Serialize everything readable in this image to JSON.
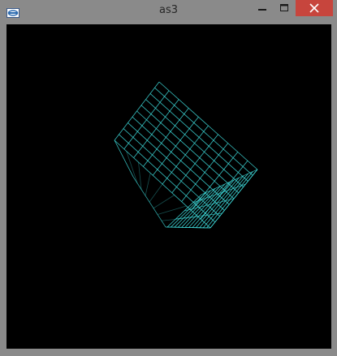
{
  "window": {
    "title": "as3",
    "icons": {
      "app": "app-icon",
      "minimize": "minimize-icon",
      "maximize": "maximize-icon",
      "close": "close-icon"
    },
    "colors": {
      "frame": "#8a8a8a",
      "close_button": "#c7453d",
      "canvas_background": "#000000",
      "wireframe": "#40e0e0"
    }
  }
}
